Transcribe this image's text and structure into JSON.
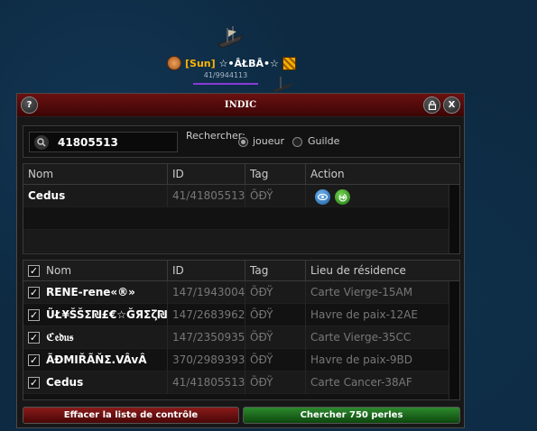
{
  "player": {
    "guild_tag": "[Sun]",
    "name": "☆•ÂŁBÂ•☆",
    "id_text": "41/9944113",
    "emblem": "guild-emblem-icon",
    "rank": "rank-stripes-icon"
  },
  "window": {
    "title": "INDIC",
    "help_label": "?",
    "close_label": "X"
  },
  "search": {
    "value": "41805513",
    "label": "Rechercher:",
    "options": [
      "joueur",
      "Guilde"
    ],
    "selected": "joueur"
  },
  "results": {
    "headers": [
      "Nom",
      "ID",
      "Tag",
      "Action"
    ],
    "rows": [
      {
        "name": "Cedus",
        "id": "41/41805513",
        "tag": "ÕÐŸ",
        "actions": [
          "eye-icon",
          "connect-icon"
        ]
      }
    ]
  },
  "watchlist": {
    "headers": [
      "Nom",
      "ID",
      "Tag",
      "Lieu de résidence"
    ],
    "rows": [
      {
        "name": "RENE-rene«®»",
        "id": "147/1943004",
        "tag": "ÕÐŸ",
        "place": "Carte Vierge-15AM",
        "checked": true
      },
      {
        "name": "ŨŁ¥ŠŠΣ₪£€☆ĞЯΣζ₪",
        "id": "147/2683962",
        "tag": "ÕÐŸ",
        "place": "Havre de paix-12AE",
        "checked": true
      },
      {
        "name": "ℭ𝔢𝔡𝔲𝔰",
        "id": "147/2350935",
        "tag": "ÕÐŸ",
        "place": "Carte Vierge-35CC",
        "checked": true
      },
      {
        "name": "ÃÐMIŘÃŇΣ.VÂvÂ",
        "id": "370/2989393",
        "tag": "ÕÐŸ",
        "place": "Havre de paix-9BD",
        "checked": true
      },
      {
        "name": "Cedus",
        "id": "41/41805513",
        "tag": "ÕÐŸ",
        "place": "Carte Cancer-38AF",
        "checked": true
      }
    ]
  },
  "buttons": {
    "clear": "Effacer la liste de contrôle",
    "search": "Chercher 750 perles"
  },
  "colors": {
    "title_bar": "#6b1111",
    "clear_button": "#8a1a1a",
    "search_button": "#2d8a2d",
    "guild_tag": "#ffb400",
    "player_bar": "#8b39d9"
  }
}
